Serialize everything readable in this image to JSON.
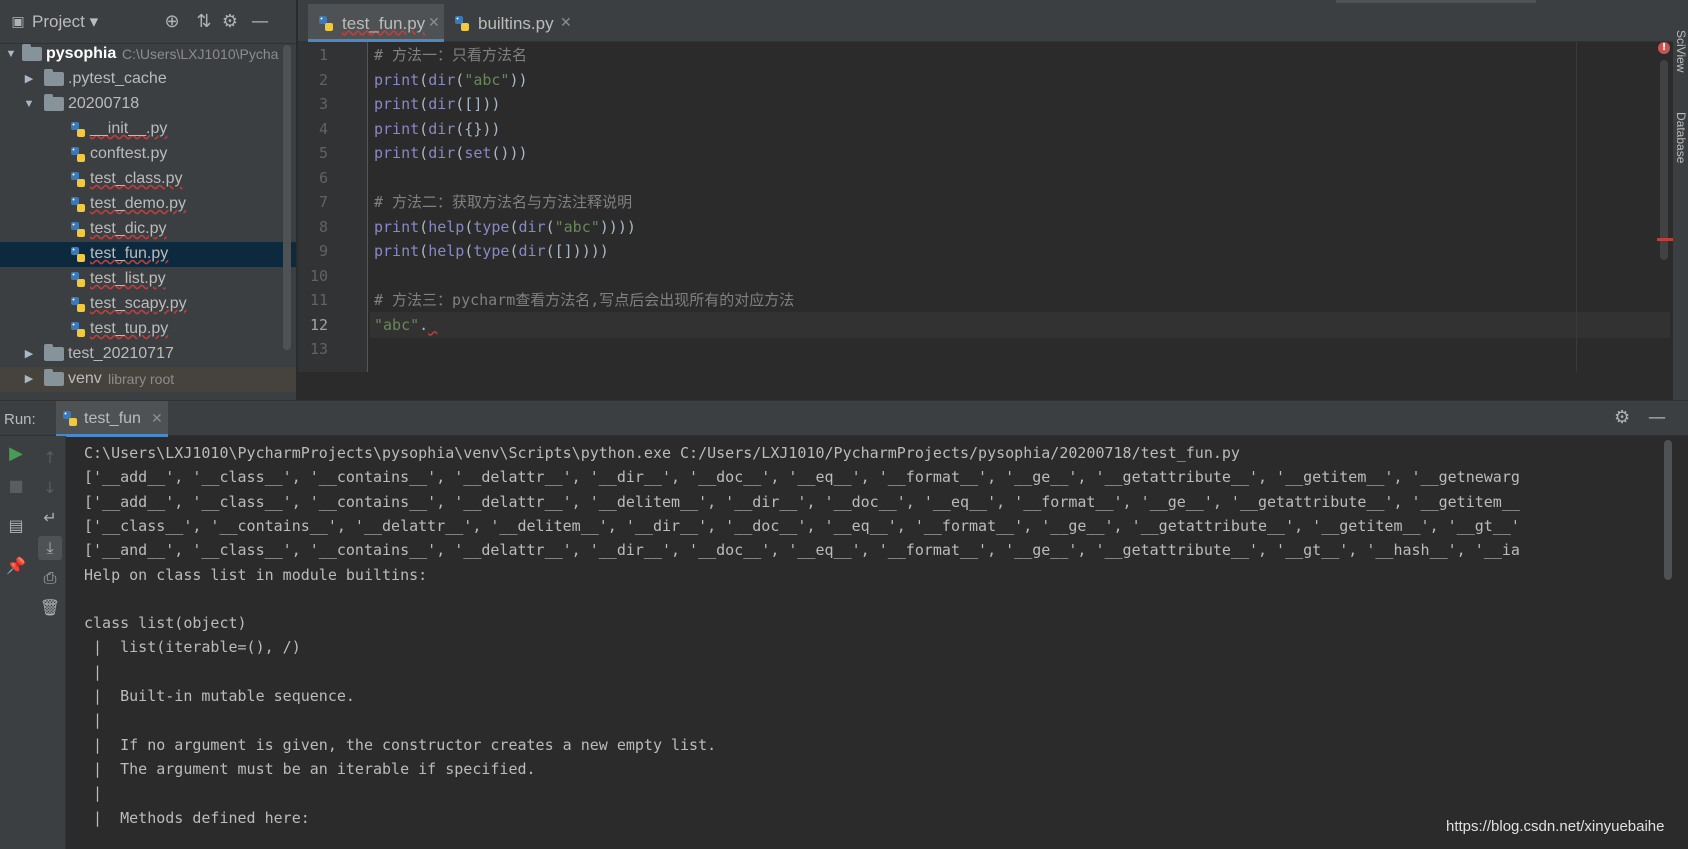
{
  "project": {
    "title": "Project",
    "tree": [
      {
        "name": "pysophia",
        "hint": "C:\\Users\\LXJ1010\\Pycha",
        "kind": "root"
      },
      {
        "name": ".pytest_cache",
        "kind": "folder"
      },
      {
        "name": "20200718",
        "kind": "folder-open"
      },
      {
        "name": "__init__.py",
        "kind": "file"
      },
      {
        "name": "conftest.py",
        "kind": "file"
      },
      {
        "name": "test_class.py",
        "kind": "file"
      },
      {
        "name": "test_demo.py",
        "kind": "file"
      },
      {
        "name": "test_dic.py",
        "kind": "file"
      },
      {
        "name": "test_fun.py",
        "kind": "file-selected"
      },
      {
        "name": "test_list.py",
        "kind": "file"
      },
      {
        "name": "test_scapy.py",
        "kind": "file"
      },
      {
        "name": "test_tup.py",
        "kind": "file"
      },
      {
        "name": "test_20210717",
        "kind": "folder"
      },
      {
        "name": "venv",
        "hint": "library root",
        "kind": "libroot"
      }
    ]
  },
  "editor": {
    "tabs": [
      {
        "label": "test_fun.py",
        "active": true
      },
      {
        "label": "builtins.py",
        "active": false
      }
    ],
    "lines": [
      {
        "n": "1",
        "text": "# 方法一：只看方法名"
      },
      {
        "n": "2",
        "text": "print(dir(\"abc\"))"
      },
      {
        "n": "3",
        "text": "print(dir([]))"
      },
      {
        "n": "4",
        "text": "print(dir({}))"
      },
      {
        "n": "5",
        "text": "print(dir(set()))"
      },
      {
        "n": "6",
        "text": ""
      },
      {
        "n": "7",
        "text": "# 方法二：获取方法名与方法注释说明"
      },
      {
        "n": "8",
        "text": "print(help(type(dir(\"abc\"))))"
      },
      {
        "n": "9",
        "text": "print(help(type(dir([]))))"
      },
      {
        "n": "10",
        "text": ""
      },
      {
        "n": "11",
        "text": "# 方法三：pycharm查看方法名,写点后会出现所有的对应方法"
      },
      {
        "n": "12",
        "text": "\"abc\"."
      },
      {
        "n": "13",
        "text": ""
      }
    ],
    "current_line": "12"
  },
  "side_stripe": {
    "top_label": "SciView",
    "bottom_label": "Database"
  },
  "run": {
    "label": "Run:",
    "tab_label": "test_fun",
    "output": [
      "C:\\Users\\LXJ1010\\PycharmProjects\\pysophia\\venv\\Scripts\\python.exe C:/Users/LXJ1010/PycharmProjects/pysophia/20200718/test_fun.py",
      "['__add__', '__class__', '__contains__', '__delattr__', '__dir__', '__doc__', '__eq__', '__format__', '__ge__', '__getattribute__', '__getitem__', '__getnewarg",
      "['__add__', '__class__', '__contains__', '__delattr__', '__delitem__', '__dir__', '__doc__', '__eq__', '__format__', '__ge__', '__getattribute__', '__getitem__",
      "['__class__', '__contains__', '__delattr__', '__delitem__', '__dir__', '__doc__', '__eq__', '__format__', '__ge__', '__getattribute__', '__getitem__', '__gt__'",
      "['__and__', '__class__', '__contains__', '__delattr__', '__dir__', '__doc__', '__eq__', '__format__', '__ge__', '__getattribute__', '__gt__', '__hash__', '__ia",
      "Help on class list in module builtins:",
      "",
      "class list(object)",
      " |  list(iterable=(), /)",
      " |",
      " |  Built-in mutable sequence.",
      " |",
      " |  If no argument is given, the constructor creates a new empty list.",
      " |  The argument must be an iterable if specified.",
      " |",
      " |  Methods defined here:"
    ]
  },
  "watermark": "https://blog.csdn.net/xinyuebaihe",
  "colors": {
    "background": "#2b2b2b",
    "panel": "#3c3f41",
    "selection": "#0d293e",
    "keyword": "#8888c6",
    "string": "#6a8759",
    "comment": "#808080",
    "accent": "#4a88c7",
    "run_green": "#499c54"
  }
}
